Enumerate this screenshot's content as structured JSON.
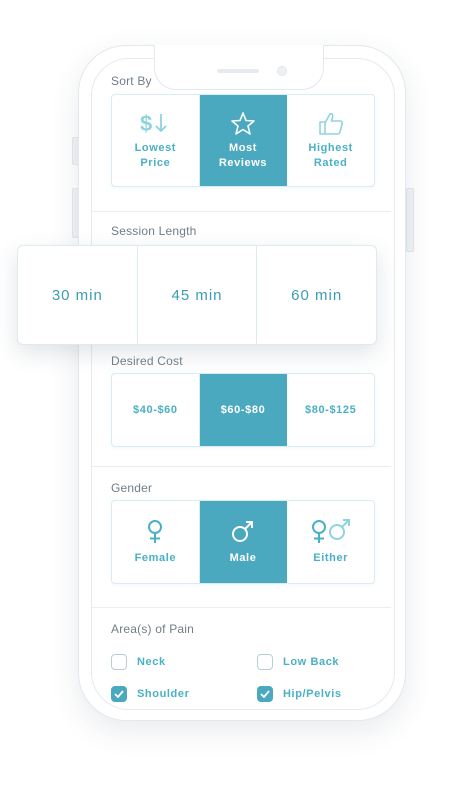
{
  "sort_by": {
    "label": "Sort By",
    "options": [
      {
        "icon": "dollar-down-icon",
        "line1": "Lowest",
        "line2": "Price",
        "selected": false
      },
      {
        "icon": "star-icon",
        "line1": "Most",
        "line2": "Reviews",
        "selected": true
      },
      {
        "icon": "thumbs-up-icon",
        "line1": "Highest",
        "line2": "Rated",
        "selected": false
      }
    ]
  },
  "session_length": {
    "label": "Session Length",
    "options": [
      "30 min",
      "45 min",
      "60 min"
    ]
  },
  "desired_cost": {
    "label": "Desired Cost",
    "options": [
      {
        "label": "$40-$60",
        "selected": false
      },
      {
        "label": "$60-$80",
        "selected": true
      },
      {
        "label": "$80-$125",
        "selected": false
      }
    ]
  },
  "gender": {
    "label": "Gender",
    "options": [
      {
        "icon": "female-icon",
        "label": "Female",
        "selected": false
      },
      {
        "icon": "male-icon",
        "label": "Male",
        "selected": true
      },
      {
        "icon": "both-genders-icon",
        "label": "Either",
        "selected": false
      }
    ]
  },
  "area_of_pain": {
    "label": "Area(s) of Pain",
    "items": [
      {
        "label": "Neck",
        "checked": false
      },
      {
        "label": "Low Back",
        "checked": false
      },
      {
        "label": "Shoulder",
        "checked": true
      },
      {
        "label": "Hip/Pelvis",
        "checked": true
      }
    ]
  },
  "colors": {
    "accent": "#4aa8bf",
    "text_accent": "#4ab0c5",
    "label": "#6f7d88"
  }
}
